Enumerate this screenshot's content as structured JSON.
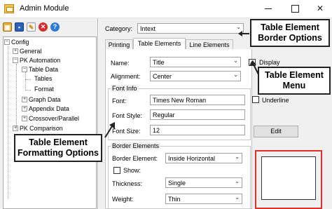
{
  "window": {
    "title": "Admin Module"
  },
  "toolbar": {
    "open": "▣",
    "save": "▪",
    "pin": "✎",
    "delete": "✕",
    "help": "?"
  },
  "tree": {
    "root": "Config",
    "general": "General",
    "pk_automation": "PK Automation",
    "table_data": "Table Data",
    "tables": "Tables",
    "format": "Format",
    "graph_data": "Graph Data",
    "appendix_data": "Appendix Data",
    "crossover": "Crossover/Parallel",
    "pk_comparison": "PK Comparison"
  },
  "category": {
    "label": "Category:",
    "value": "Intext"
  },
  "tabs": [
    "Printing",
    "Table Elements",
    "Line Elements"
  ],
  "form": {
    "name_label": "Name:",
    "name_value": "Title",
    "display_label": "Display",
    "alignment_label": "Alignment:",
    "alignment_value": "Center",
    "font_info_title": "Font Info",
    "font_label": "Font:",
    "font_value": "Times New Roman",
    "underline_label": "Underline",
    "font_style_label": "Font Style:",
    "font_style_value": "Regular",
    "font_size_label": "Font Size:",
    "font_size_value": "12",
    "edit_label": "Edit",
    "border_title": "Border Elements",
    "border_element_label": "Border Element:",
    "border_element_value": "Inside Horizontal",
    "show_label": "Show:",
    "thickness_label": "Thickness:",
    "thickness_value": "Single",
    "weight_label": "Weight:",
    "weight_value": "Thin"
  },
  "callouts": {
    "border_options": [
      "Table Element",
      "Border Options"
    ],
    "element_menu": [
      "Table Element",
      "Menu"
    ],
    "formatting_options": [
      "Table Element",
      "Formatting Options"
    ]
  },
  "colors": {
    "preview_border": "#e0302a"
  }
}
